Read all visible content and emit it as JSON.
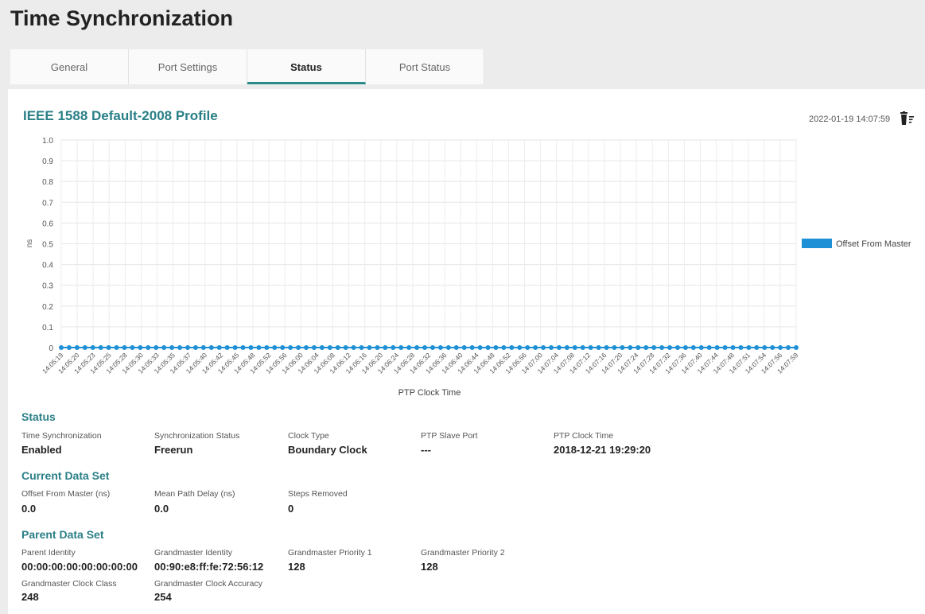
{
  "page_title": "Time Synchronization",
  "tabs": [
    "General",
    "Port Settings",
    "Status",
    "Port Status"
  ],
  "active_tab": 2,
  "profile_title": "IEEE 1588 Default-2008 Profile",
  "timestamp": "2022-01-19 14:07:59",
  "colors": {
    "accent": "#2a7f86",
    "series": "#1e90d6"
  },
  "icons": {
    "clear": "trash-filter-icon"
  },
  "chart_data": {
    "type": "line",
    "ylabel": "ns",
    "xlabel": "PTP Clock Time",
    "ylim": [
      0,
      1.0
    ],
    "yticks": [
      "1.0",
      "0.9",
      "0.8",
      "0.7",
      "0.6",
      "0.5",
      "0.4",
      "0.3",
      "0.2",
      "0.1",
      "0"
    ],
    "grid": true,
    "legend_position": "right",
    "x": [
      "14:05:19",
      "14:05:20",
      "14:05:23",
      "14:05:25",
      "14:05:28",
      "14:05:30",
      "14:05:33",
      "14:05:35",
      "14:05:37",
      "14:05:40",
      "14:05:42",
      "14:05:45",
      "14:05:48",
      "14:05:52",
      "14:05:56",
      "14:06:00",
      "14:06:04",
      "14:06:08",
      "14:06:12",
      "14:06:16",
      "14:06:20",
      "14:06:24",
      "14:06:28",
      "14:06:32",
      "14:06:36",
      "14:06:40",
      "14:06:44",
      "14:06:48",
      "14:06:52",
      "14:06:56",
      "14:07:00",
      "14:07:04",
      "14:07:08",
      "14:07:12",
      "14:07:16",
      "14:07:20",
      "14:07:24",
      "14:07:28",
      "14:07:32",
      "14:07:36",
      "14:07:40",
      "14:07:44",
      "14:07:48",
      "14:07:51",
      "14:07:54",
      "14:07:56",
      "14:07:59"
    ],
    "series": [
      {
        "name": "Offset From Master",
        "values": [
          0,
          0,
          0,
          0,
          0,
          0,
          0,
          0,
          0,
          0,
          0,
          0,
          0,
          0,
          0,
          0,
          0,
          0,
          0,
          0,
          0,
          0,
          0,
          0,
          0,
          0,
          0,
          0,
          0,
          0,
          0,
          0,
          0,
          0,
          0,
          0,
          0,
          0,
          0,
          0,
          0,
          0,
          0,
          0,
          0,
          0,
          0,
          0,
          0,
          0,
          0,
          0,
          0,
          0,
          0,
          0,
          0,
          0,
          0,
          0,
          0,
          0,
          0,
          0,
          0,
          0,
          0,
          0,
          0,
          0,
          0,
          0,
          0,
          0,
          0,
          0,
          0,
          0,
          0,
          0,
          0,
          0,
          0,
          0,
          0,
          0,
          0,
          0,
          0,
          0,
          0,
          0,
          0,
          0
        ]
      }
    ]
  },
  "status": {
    "heading": "Status",
    "fields": [
      {
        "label": "Time Synchronization",
        "value": "Enabled"
      },
      {
        "label": "Synchronization Status",
        "value": "Freerun"
      },
      {
        "label": "Clock Type",
        "value": "Boundary Clock"
      },
      {
        "label": "PTP Slave Port",
        "value": "---"
      },
      {
        "label": "PTP Clock Time",
        "value": "2018-12-21 19:29:20"
      }
    ]
  },
  "current": {
    "heading": "Current Data Set",
    "fields": [
      {
        "label": "Offset From Master (ns)",
        "value": "0.0"
      },
      {
        "label": "Mean Path Delay (ns)",
        "value": "0.0"
      },
      {
        "label": "Steps Removed",
        "value": "0"
      }
    ]
  },
  "parent": {
    "heading": "Parent Data Set",
    "fields": [
      {
        "label": "Parent Identity",
        "value": "00:00:00:00:00:00:00:00"
      },
      {
        "label": "Grandmaster Identity",
        "value": "00:90:e8:ff:fe:72:56:12"
      },
      {
        "label": "Grandmaster Priority 1",
        "value": "128"
      },
      {
        "label": "Grandmaster Priority 2",
        "value": "128"
      },
      {
        "label": "Grandmaster Clock Class",
        "value": "248"
      },
      {
        "label": "Grandmaster Clock Accuracy",
        "value": "254"
      }
    ]
  }
}
